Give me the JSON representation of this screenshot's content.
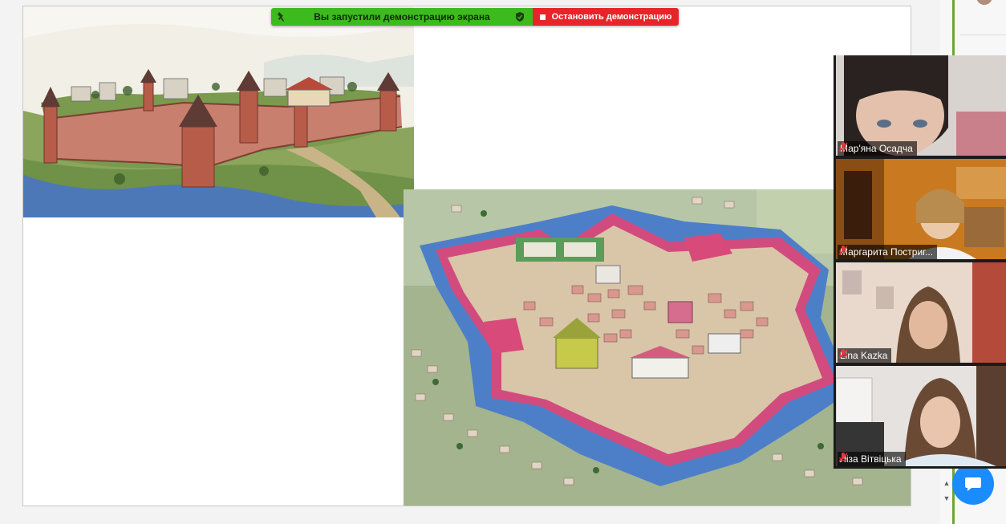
{
  "share_banner": {
    "status_text": "Вы запустили демонстрацию экрана",
    "stop_label": "Остановить демонстрацию",
    "status_color": "#3dba1e",
    "stop_color": "#e8242a"
  },
  "slide": {
    "images": [
      {
        "name": "castle-fortress-sketch"
      },
      {
        "name": "star-fortress-model"
      }
    ]
  },
  "participants": [
    {
      "name": "Мар'яна  Осадча",
      "muted": true,
      "active_speaker": true
    },
    {
      "name": "Маргарита Постриг...",
      "muted": true,
      "active_speaker": false
    },
    {
      "name": "Lina Kazka",
      "muted": true,
      "active_speaker": false
    },
    {
      "name": "Ліза Вітвіцька",
      "muted": true,
      "active_speaker": false
    }
  ],
  "icons": {
    "pin": "pin-icon",
    "shield": "shield-check-icon",
    "stop": "stop-square-icon",
    "mic_off": "microphone-muted-icon",
    "chat": "chat-bubble-icon"
  },
  "colors": {
    "accent_green": "#6ea434",
    "chat_button": "#1a8cff",
    "mic_muted": "#e03a3a"
  }
}
